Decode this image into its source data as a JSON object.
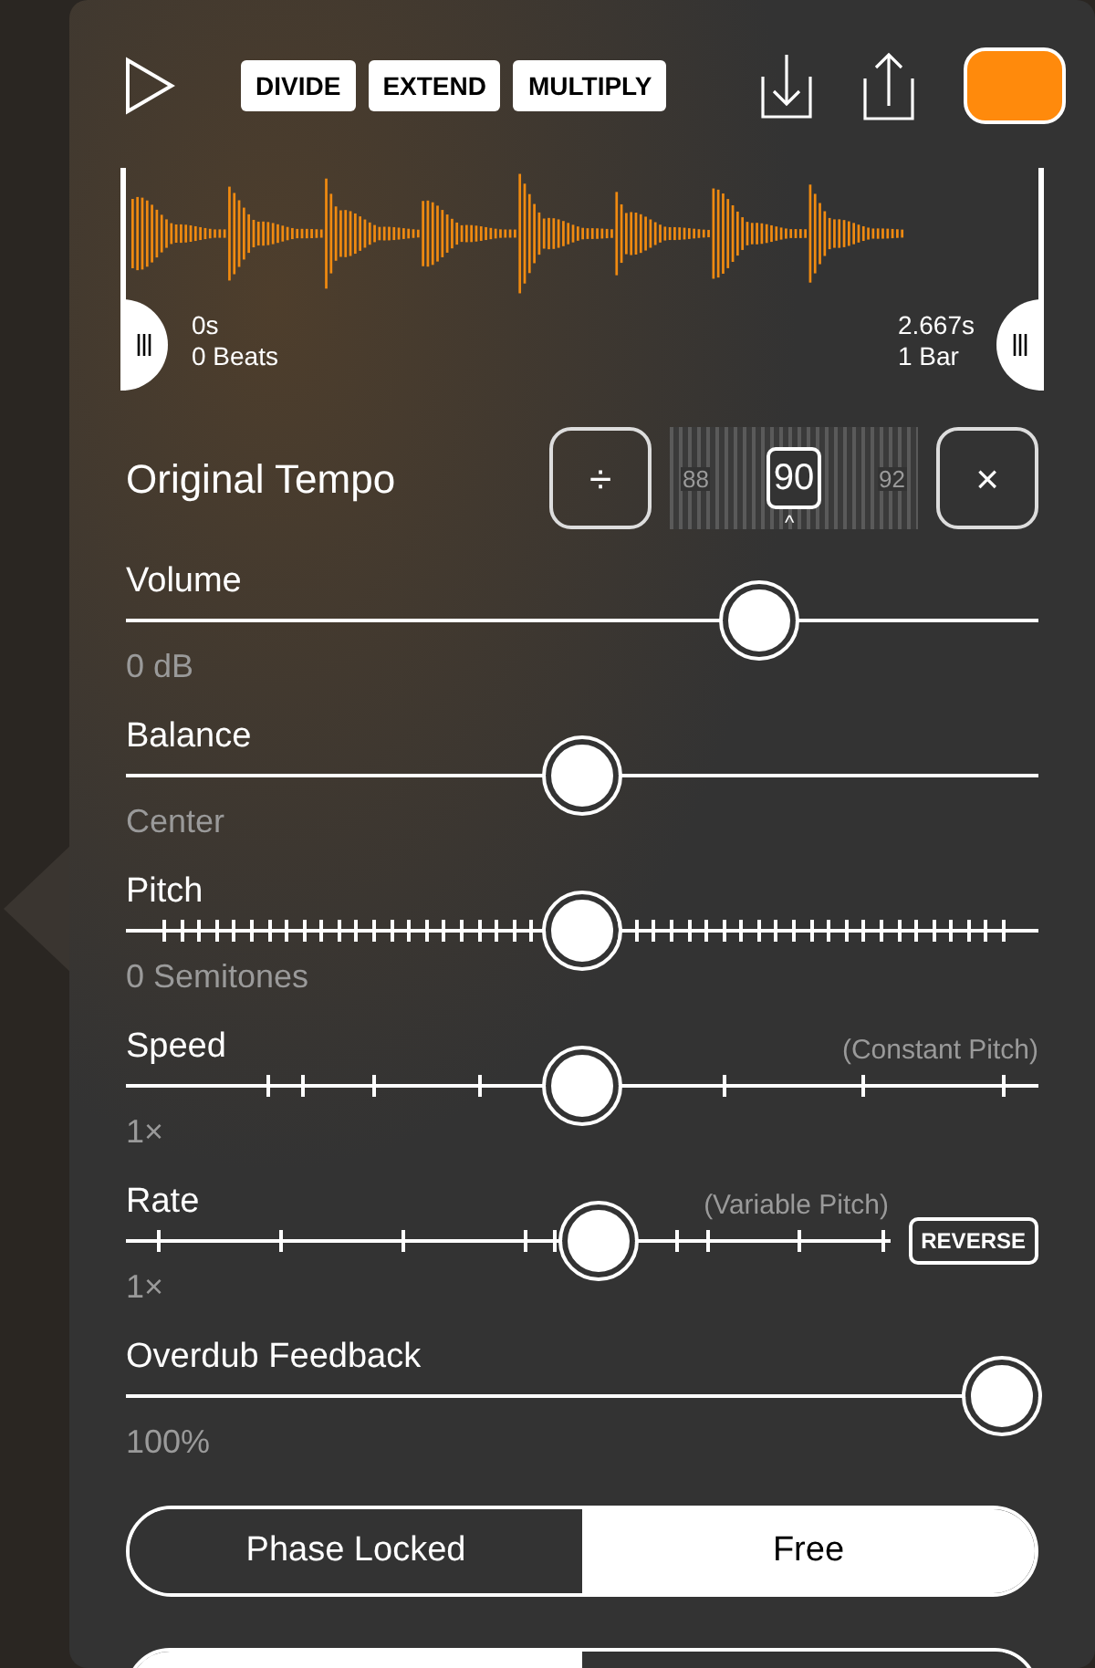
{
  "toolbar": {
    "buttons": [
      "DIVIDE",
      "EXTEND",
      "MULTIPLY"
    ],
    "color": "#ff8a0c"
  },
  "loop": {
    "start_time": "0s",
    "start_beats": "0 Beats",
    "end_time": "2.667s",
    "end_beats": "1 Bar"
  },
  "tempo": {
    "label": "Original Tempo",
    "divide": "÷",
    "multiply": "×",
    "value": "90",
    "prev": "88",
    "next": "92",
    "caret": "^"
  },
  "sliders": [
    {
      "kind": "plain",
      "label": "Volume",
      "value": "0 dB",
      "level": 0.71
    },
    {
      "kind": "plain",
      "label": "Balance",
      "value": "Center",
      "level": 0.5
    },
    {
      "kind": "pitch",
      "label": "Pitch",
      "value": "0 Semitones",
      "level": 0.5
    },
    {
      "kind": "speed",
      "label": "Speed",
      "note": "(Constant Pitch)",
      "value": "1×",
      "level": 0.5
    },
    {
      "kind": "rate",
      "label": "Rate",
      "note": "(Variable Pitch)",
      "value": "1×",
      "level": 0.63,
      "button": "REVERSE"
    },
    {
      "kind": "plain",
      "label": "Overdub Feedback",
      "value": "100%",
      "level": 1
    }
  ],
  "sync": [
    {
      "label": "Phase Locked",
      "selected": false
    },
    {
      "label": "Free",
      "selected": true
    }
  ]
}
